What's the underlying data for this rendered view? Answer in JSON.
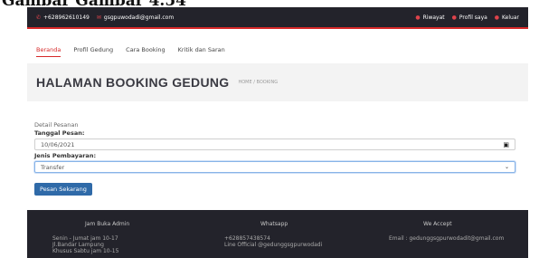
{
  "caption": "Gambar Gambar 4.54",
  "topbar": {
    "phone": "+628962610149",
    "email": "gsgpuwodadi@gmail.com",
    "links": [
      "Riwayat",
      "Profil saya",
      "Keluar"
    ]
  },
  "nav": {
    "items": [
      "Beranda",
      "Profil Gedung",
      "Cara Booking",
      "Kritik dan Saran"
    ],
    "active": "Beranda"
  },
  "page": {
    "title": "HALAMAN BOOKING GEDUNG",
    "breadcrumb_home": "HOME",
    "breadcrumb_sep": "/",
    "breadcrumb_current": "BOOKING"
  },
  "form": {
    "section_title": "Detail Pesanan",
    "date_label": "Tanggal Pesan:",
    "date_value": "10/06/2021",
    "payment_label": "Jenis Pembayaran:",
    "payment_value": "Transfer",
    "submit_label": "Pesan Sekarang"
  },
  "footer": {
    "hours_title": "Jam Buka Admin",
    "hours_lines": [
      "Senin - Jumat jam 10-17",
      "Jl.Bandar Lampung",
      "Khusus Sabtu jam 10-15"
    ],
    "wa_title": "Whatsapp",
    "wa_lines": [
      "+628857438574",
      "Line Official @gedunggsgpurwodadi"
    ],
    "accept_title": "We Accept",
    "accept_line": "Email : gedunggsgpurwodadit@gmail.com"
  },
  "colors": {
    "accent": "#d62828",
    "dark": "#23232b",
    "button": "#2f6aa8"
  },
  "icons": {
    "phone": "phone-icon",
    "email": "email-icon",
    "calendar": "calendar-icon",
    "dropdown": "chevron-down-icon"
  }
}
